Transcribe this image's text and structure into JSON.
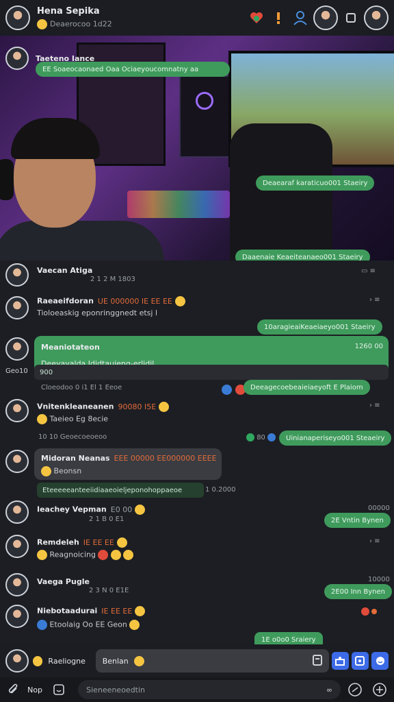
{
  "header": {
    "name": "Hena Sepika",
    "subtitle": "Deaerocoo 1d22"
  },
  "video_overlay": {
    "top_name": "Taeteno Iance",
    "top_msg": "EE Soaeocaonaed  Oaa Ociaeyoucomnatny aa",
    "pill_mid": "Deaearaf karaticuo001 Staeiry",
    "pill_bottom": "Daaenaie Keaeiteanaeo001 Staeiry"
  },
  "messages": [
    {
      "name": "Vaecan Atiga",
      "time": "2 1 2 M 1803"
    },
    {
      "name": "Raeaeifdoran",
      "tag": "UE 000000 IE EE EE",
      "text": "Tioloeaskig eponringgnedt etsj l",
      "pill": "10aragieaiKeaeiaeyo001 Staeiry"
    },
    {
      "name": "Meaniotateon",
      "text": "Deeyayalda Ididtaujeng-erlidil.",
      "time": "1260 00",
      "side": "Geo10",
      "sub": "900",
      "reply_meta": "Cloeodoo 0 i1 El 1 Eeoe",
      "pill": "Deeagecoebeaieiaeyoft E Plaiom"
    },
    {
      "name": "Vnitenkleaneanen",
      "tag": "90080 I5E",
      "sub": "Taeieo Eg 8ecie",
      "meta": "10 10 Geoecoeoeoo",
      "meta2": "80",
      "pill": "Uinianaperiseyo001 Steaeiry"
    },
    {
      "name": "Midoran Neanas",
      "tag": "EEE 00000 EE000000 EEEE",
      "sub": "Beonsn",
      "pill": "Eteeeeeanteeiidiaaeoieljeponohoppaeoe",
      "meta": "1 0.2000"
    },
    {
      "name": "Ieachey Vepman",
      "tag": "E0 00",
      "time": "00000",
      "sub": "2 1 B 0 E1",
      "pill": "2E Vntin Bynen"
    },
    {
      "name": "Remdeleh",
      "tag": "IE EE EE",
      "sub": "Reagnoicing"
    },
    {
      "name": "Vaega Pugle",
      "time": "10000",
      "sub": "2 3 N 0 E1E",
      "pill": "2E00 Inn Bynen"
    },
    {
      "name": "Niebotaadurai",
      "tag": "IE EE EE",
      "sub": "Etoolaig Oo EE Geon",
      "pill": "1E o0o0 Sraiery"
    }
  ],
  "input_bar": {
    "name": "Raeliogne",
    "field": "Benlan"
  },
  "composer": {
    "label": "Nop",
    "placeholder": "Sieneeneoedtin"
  }
}
